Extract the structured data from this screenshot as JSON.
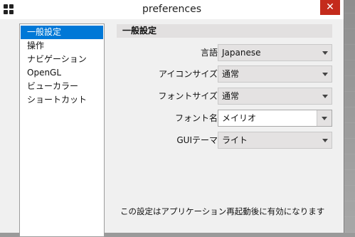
{
  "window": {
    "title": "preferences"
  },
  "sidebar": {
    "items": [
      {
        "label": "一般設定",
        "selected": true
      },
      {
        "label": "操作"
      },
      {
        "label": "ナビゲーション"
      },
      {
        "label": "OpenGL"
      },
      {
        "label": "ビューカラー"
      },
      {
        "label": "ショートカット"
      }
    ]
  },
  "main": {
    "section_title": "一般設定",
    "settings": {
      "language": {
        "label": "言語",
        "value": "Japanese"
      },
      "icon_size": {
        "label": "アイコンサイズ",
        "value": "通常"
      },
      "font_size": {
        "label": "フォントサイズ",
        "value": "通常"
      },
      "font_name": {
        "label": "フォント名",
        "value": "メイリオ"
      },
      "gui_theme": {
        "label": "GUIテーマ",
        "value": "ライト"
      }
    },
    "note": "この設定はアプリケーション再起動後に有効になります"
  },
  "icons": {
    "app": "grid-app-icon",
    "close": "close-icon",
    "dropdown": "chevron-down-icon"
  },
  "colors": {
    "selection": "#0078d7",
    "close": "#c42b1c"
  }
}
